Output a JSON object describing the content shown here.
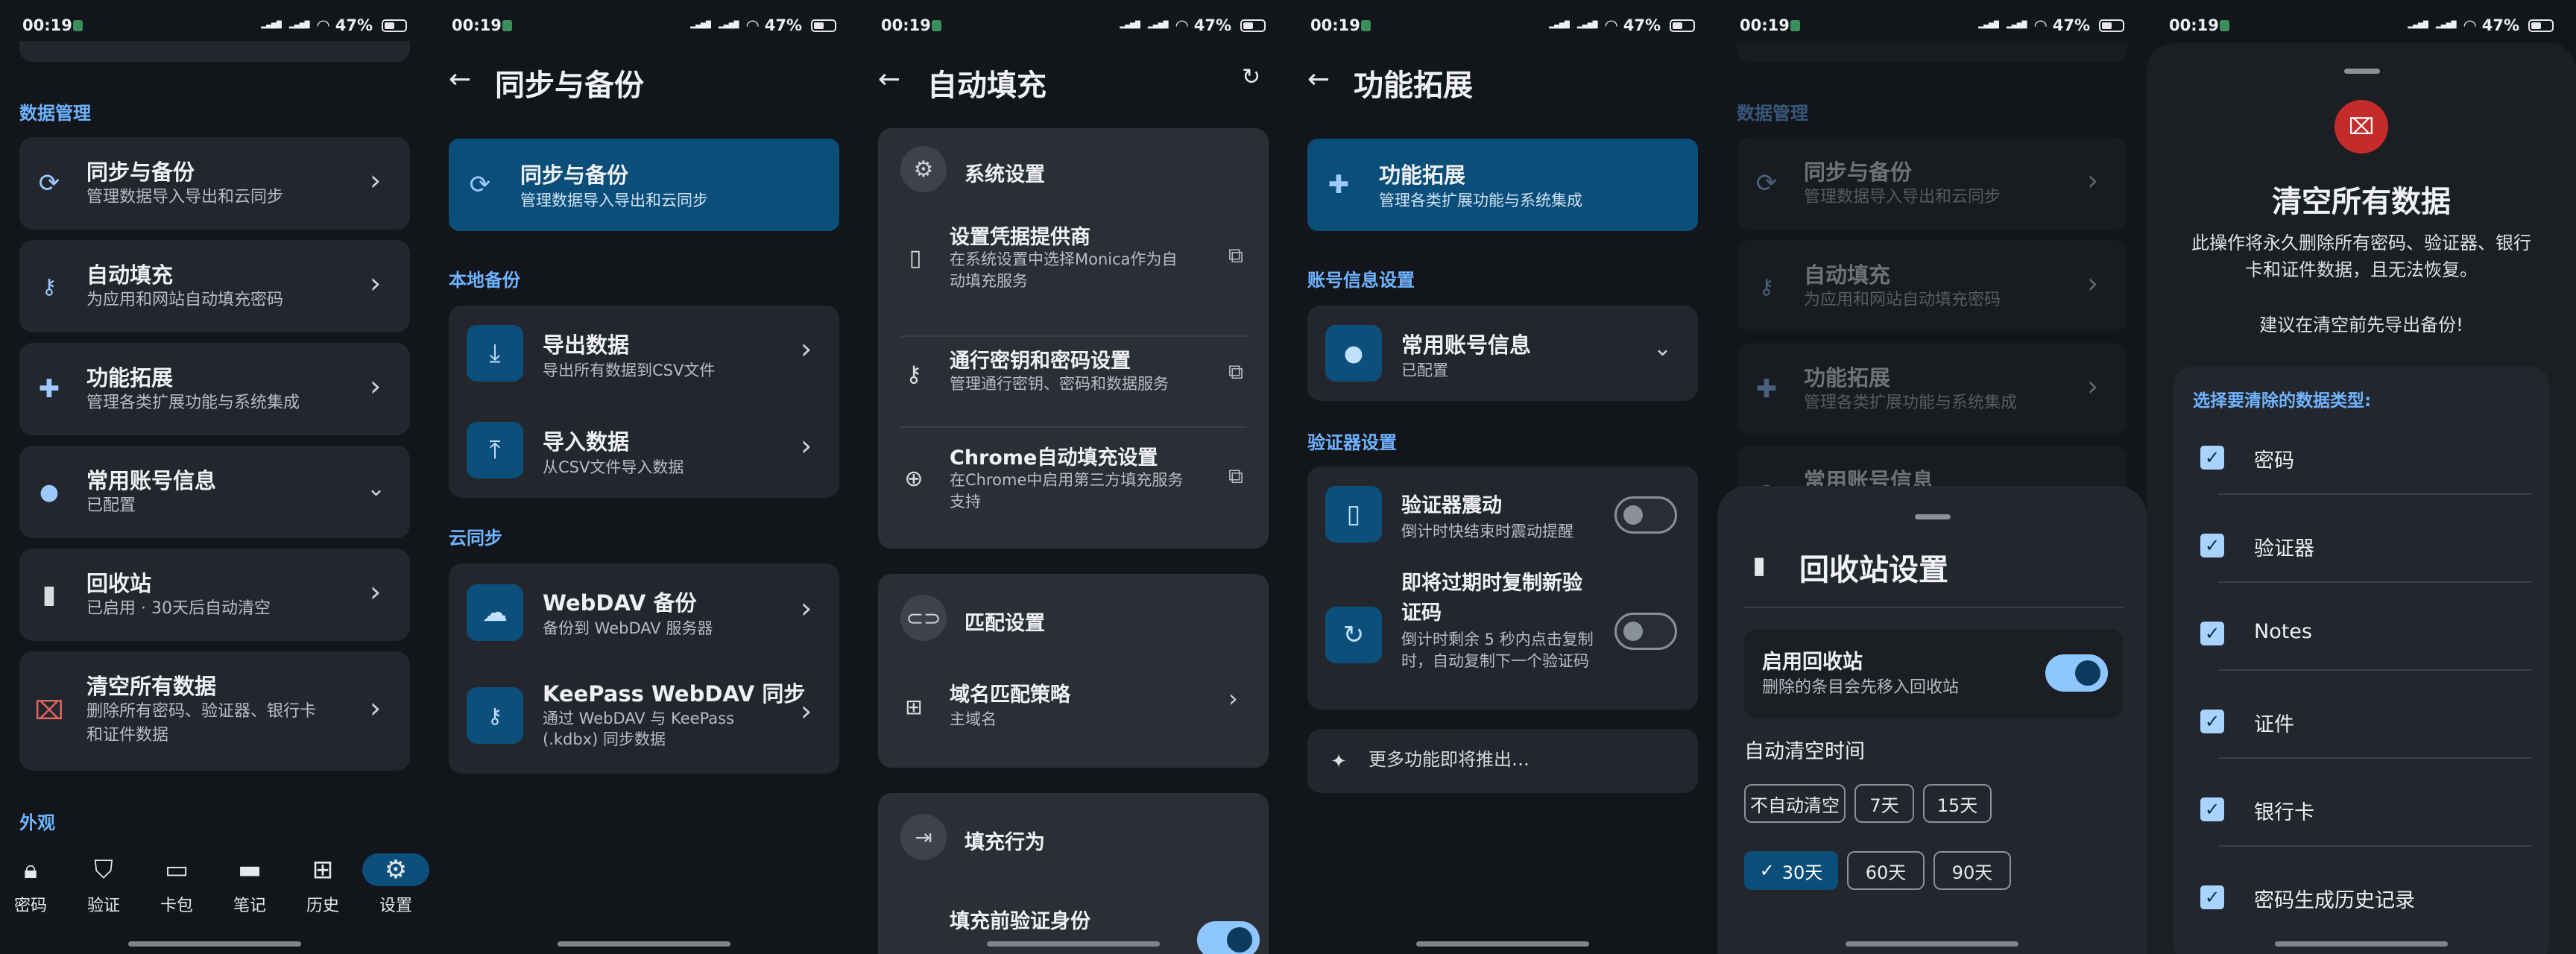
{
  "status": {
    "time": "00:19",
    "battery": "47%"
  },
  "p1": {
    "section_data": "数据管理",
    "items": [
      {
        "title": "同步与备份",
        "sub": "管理数据导入导出和云同步",
        "icon": "sync-icon"
      },
      {
        "title": "自动填充",
        "sub": "为应用和网站自动填充密码",
        "icon": "key-icon"
      },
      {
        "title": "功能拓展",
        "sub": "管理各类扩展功能与系统集成",
        "icon": "puzzle-icon"
      },
      {
        "title": "常用账号信息",
        "sub": "已配置",
        "icon": "person-icon"
      },
      {
        "title": "回收站",
        "sub": "已启用 · 30天后自动清空",
        "icon": "trash-icon"
      },
      {
        "title": "清空所有数据",
        "sub": "删除所有密码、验证器、银行卡",
        "sub2": "和证件数据",
        "icon": "delete-forever-icon"
      }
    ],
    "section_appearance": "外观",
    "nav": [
      {
        "label": "密码",
        "icon": "lock-icon"
      },
      {
        "label": "验证",
        "icon": "shield-icon"
      },
      {
        "label": "卡包",
        "icon": "card-icon"
      },
      {
        "label": "笔记",
        "icon": "note-icon"
      },
      {
        "label": "历史",
        "icon": "history-icon"
      },
      {
        "label": "设置",
        "icon": "settings-icon"
      }
    ]
  },
  "p2": {
    "title": "同步与备份",
    "hero": {
      "title": "同步与备份",
      "sub": "管理数据导入导出和云同步"
    },
    "local_label": "本地备份",
    "export": {
      "title": "导出数据",
      "sub": "导出所有数据到CSV文件"
    },
    "import": {
      "title": "导入数据",
      "sub": "从CSV文件导入数据"
    },
    "cloud_label": "云同步",
    "webdav": {
      "title": "WebDAV 备份",
      "sub": "备份到 WebDAV 服务器"
    },
    "keepass": {
      "title": "KeePass WebDAV 同步",
      "sub1": "通过 WebDAV 与 KeePass",
      "sub2": "(.kdbx) 同步数据"
    }
  },
  "p3": {
    "title": "自动填充",
    "system_label": "系统设置",
    "provider": {
      "title": "设置凭据提供商",
      "sub1": "在系统设置中选择Monica作为自",
      "sub2": "动填充服务"
    },
    "passkey": {
      "title": "通行密钥和密码设置",
      "sub": "管理通行密钥、密码和数据服务"
    },
    "chrome": {
      "title": "Chrome自动填充设置",
      "sub1": "在Chrome中启用第三方填充服务",
      "sub2": "支持"
    },
    "match_label": "匹配设置",
    "domain": {
      "title": "域名匹配策略",
      "sub": "主域名"
    },
    "fill_label": "填充行为",
    "verify": {
      "title": "填充前验证身份"
    }
  },
  "p4": {
    "title": "功能拓展",
    "hero": {
      "title": "功能拓展",
      "sub": "管理各类扩展功能与系统集成"
    },
    "account_label": "账号信息设置",
    "account": {
      "title": "常用账号信息",
      "sub": "已配置"
    },
    "auth_label": "验证器设置",
    "vibrate": {
      "title": "验证器震动",
      "sub": "倒计时快结束时震动提醒"
    },
    "copy": {
      "title1": "即将过期时复制新验",
      "title2": "证码",
      "sub1": "倒计时剩余 5 秒内点击复制",
      "sub2": "时，自动复制下一个验证码"
    },
    "more": "更多功能即将推出…"
  },
  "p5": {
    "section_data": "数据管理",
    "sheet_title": "回收站设置",
    "enable": {
      "title": "启用回收站",
      "sub": "删除的条目会先移入回收站"
    },
    "auto_label": "自动清空时间",
    "chips": [
      "不自动清空",
      "7天",
      "15天",
      "30天",
      "60天",
      "90天"
    ],
    "selected": "30天"
  },
  "p6": {
    "title": "清空所有数据",
    "desc1": "此操作将永久删除所有密码、验证器、银行",
    "desc2": "卡和证件数据，且无法恢复。",
    "advice": "建议在清空前先导出备份!",
    "select_label": "选择要清除的数据类型:",
    "options": [
      "密码",
      "验证器",
      "Notes",
      "证件",
      "银行卡",
      "密码生成历史记录"
    ]
  }
}
